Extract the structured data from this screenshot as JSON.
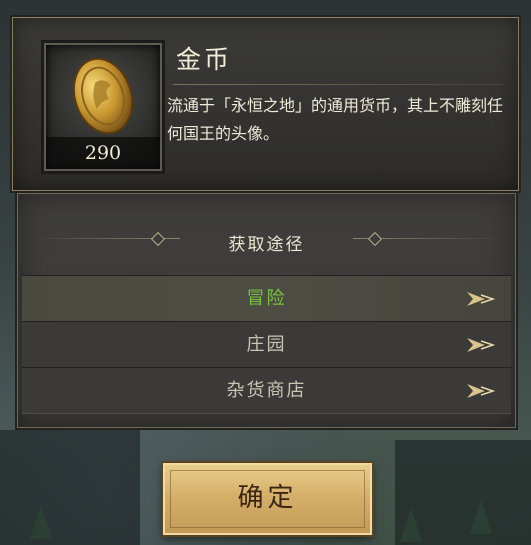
{
  "item": {
    "name": "金币",
    "quantity": "290",
    "description": "流通于「永恒之地」的通用货币，其上不雕刻任何国王的头像。",
    "icon": "gold-coin-icon"
  },
  "sources": {
    "heading": "获取途径",
    "items": [
      {
        "label": "冒险",
        "color": "#79c23d"
      },
      {
        "label": "庄园",
        "color": "#c9c4b4"
      },
      {
        "label": "杂货商店",
        "color": "#c9c4b4"
      }
    ]
  },
  "confirm_label": "确定",
  "colors": {
    "accent_gold": "#d5b06b",
    "highlight_green": "#79c23d"
  }
}
